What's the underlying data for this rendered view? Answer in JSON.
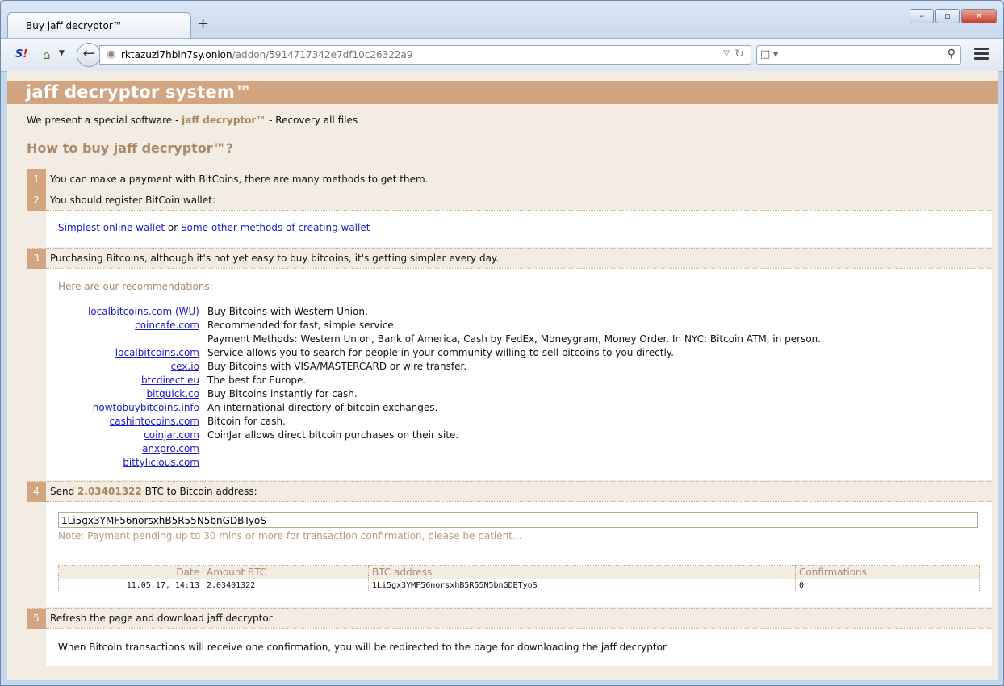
{
  "browser": {
    "tab_title": "Buy jaff decryptor™",
    "new_tab_glyph": "+",
    "url_host": "rktazuzi7hbln7sy.onion",
    "url_path": "/addon/5914717342e7df10c26322a9",
    "window_buttons": [
      "–",
      "▫",
      "✕"
    ]
  },
  "page": {
    "banner_title": "jaff decryptor system™",
    "intro_prefix": "We present a special software - ",
    "intro_product": "jaff decryptor™",
    "intro_suffix": " - Recovery all files",
    "howto_title": "How to buy jaff decryptor™?",
    "steps": [
      {
        "num": "1",
        "text": "You can make a payment with BitCoins, there are many methods to get them."
      },
      {
        "num": "2",
        "text": "You should register BitCoin wallet:"
      },
      {
        "num": "3",
        "text": "Purchasing Bitcoins, although it's not yet easy to buy bitcoins, it's getting simpler every day."
      },
      {
        "num": "4",
        "text_prefix": "Send ",
        "amount": "2.03401322",
        "text_suffix": " BTC to Bitcoin address:"
      },
      {
        "num": "5",
        "text": "Refresh the page and download jaff decryptor"
      }
    ],
    "wallet": {
      "link1": "Simplest online wallet",
      "or": " or ",
      "link2": "Some other methods of creating wallet"
    },
    "recommendations_title": "Here are our recommendations:",
    "recommendations": [
      {
        "site": "localbitcoins.com (WU)",
        "desc": "Buy Bitcoins with Western Union."
      },
      {
        "site": "coincafe.com",
        "desc": "Recommended for fast, simple service."
      },
      {
        "site": "",
        "desc": "Payment Methods: Western Union, Bank of America, Cash by FedEx, Moneygram, Money Order. In NYC: Bitcoin ATM, in person."
      },
      {
        "site": "localbitcoins.com",
        "desc": "Service allows you to search for people in your community willing to sell bitcoins to you directly."
      },
      {
        "site": "cex.io",
        "desc": "Buy Bitcoins with VISA/MASTERCARD or wire transfer."
      },
      {
        "site": "btcdirect.eu",
        "desc": "The best for Europe."
      },
      {
        "site": "bitquick.co",
        "desc": "Buy Bitcoins instantly for cash."
      },
      {
        "site": "howtobuybitcoins.info",
        "desc": "An international directory of bitcoin exchanges."
      },
      {
        "site": "cashintocoins.com",
        "desc": "Bitcoin for cash."
      },
      {
        "site": "coinjar.com",
        "desc": "CoinJar allows direct bitcoin purchases on their site."
      },
      {
        "site": "anxpro.com",
        "desc": ""
      },
      {
        "site": "bittylicious.com",
        "desc": ""
      }
    ],
    "btc_address": "1Li5gx3YMF56norsxhB5R55N5bnGDBTyoS",
    "note": "Note: Payment pending up to 30 mins or more for transaction confirmation, please be patient...",
    "tx_table": {
      "headers": [
        "Date",
        "Amount BTC",
        "BTC address",
        "Confirmations"
      ],
      "rows": [
        [
          "11.05.17, 14:13",
          "2.03401322",
          "1Li5gx3YMF56norsxhB5R55N5bnGDBTyoS",
          "0"
        ]
      ]
    },
    "final_text": "When Bitcoin transactions will receive one confirmation, you will be redirected to the page for downloading the jaff decryptor"
  }
}
